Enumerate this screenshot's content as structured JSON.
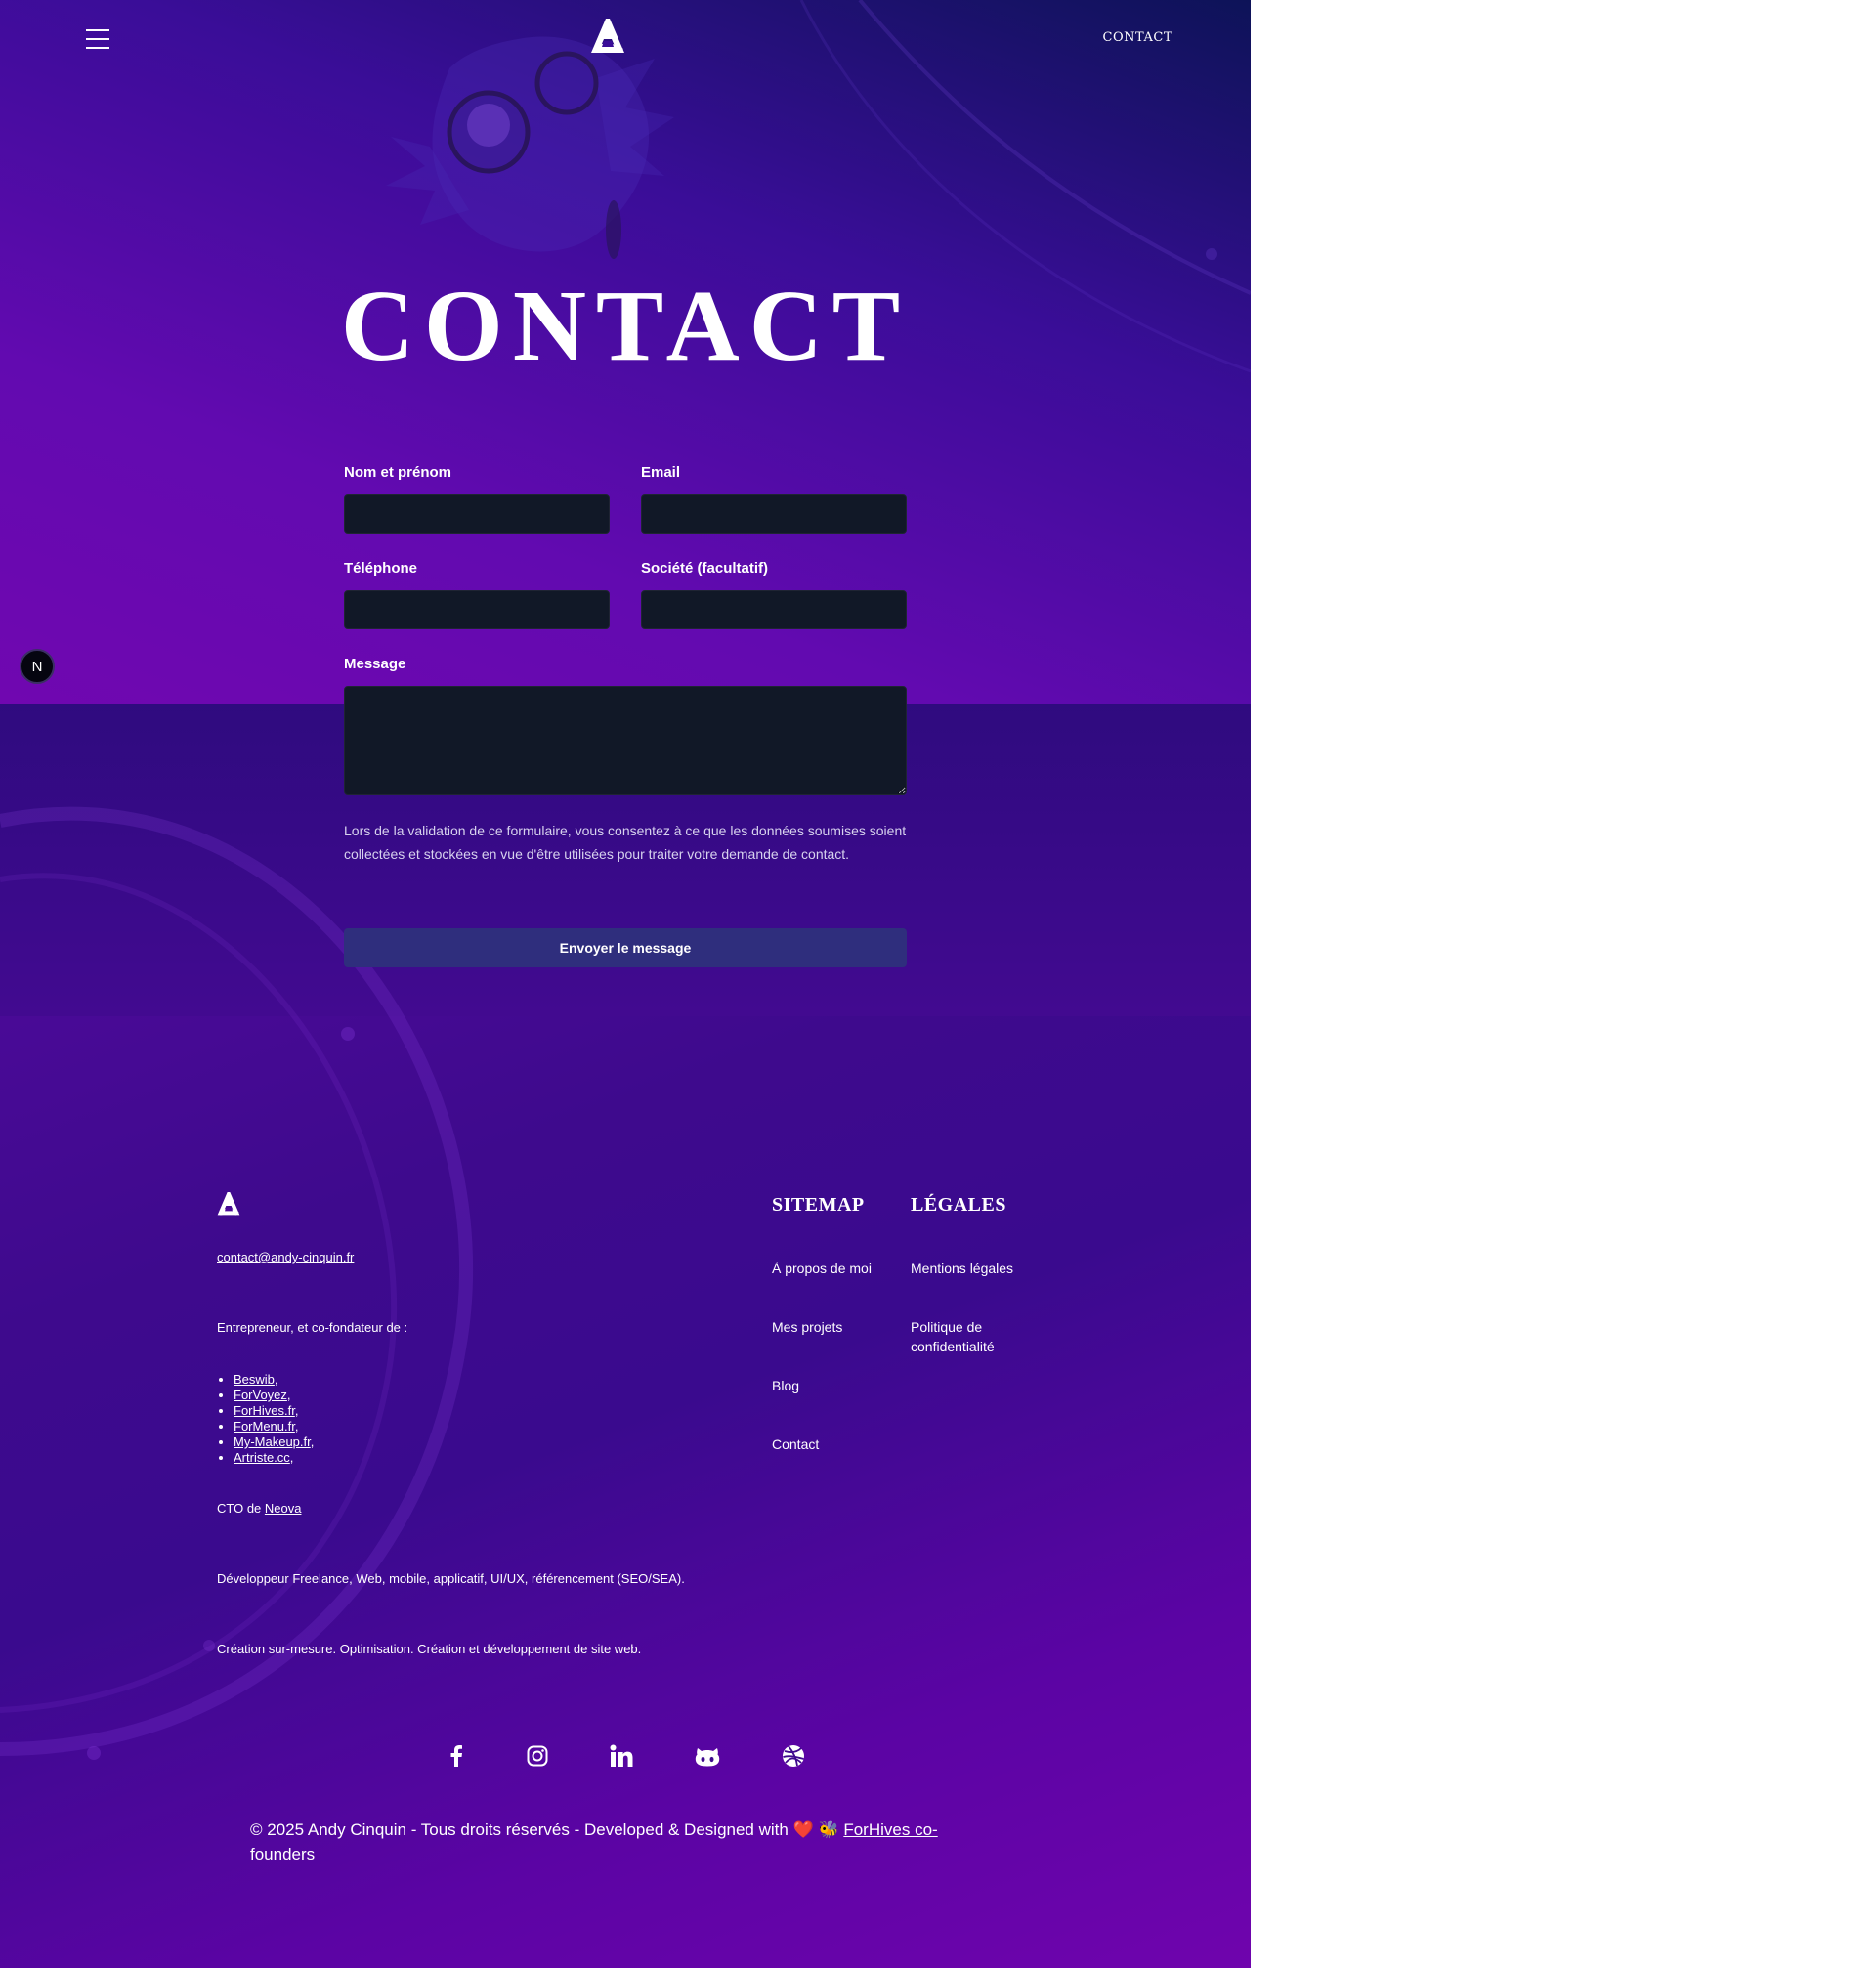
{
  "header": {
    "menu_icon": "hamburger-menu-icon",
    "logo_icon": "andy-cinquin-logo",
    "contact_link": "CONTACT"
  },
  "page": {
    "title": "CONTACT"
  },
  "form": {
    "name_label": "Nom et prénom",
    "name_value": "",
    "email_label": "Email",
    "email_value": "",
    "phone_label": "Téléphone",
    "phone_value": "",
    "company_label": "Société (facultatif)",
    "company_value": "",
    "message_label": "Message",
    "message_value": "",
    "consent_text": "Lors de la validation de ce formulaire, vous consentez à ce que les données soumises soient collectées et stockées en vue d'être utilisées pour traiter votre demande de contact.",
    "submit_label": "Envoyer le message"
  },
  "dev_badge": {
    "label": "N"
  },
  "footer": {
    "email": "contact@andy-cinquin.fr",
    "intro": "Entrepreneur, et co-fondateur de :",
    "ventures": [
      {
        "name": "Beswib",
        "sep": ","
      },
      {
        "name": "ForVoyez",
        "sep": ","
      },
      {
        "name": "ForHives.fr",
        "sep": ","
      },
      {
        "name": "ForMenu.fr",
        "sep": ","
      },
      {
        "name": "My-Makeup.fr",
        "sep": ","
      },
      {
        "name": "Artriste.cc",
        "sep": ","
      }
    ],
    "cto_prefix": "CTO de ",
    "cto_company": "Neova",
    "dev_line": "Développeur Freelance, Web, mobile, applicatif, UI/UX, référencement (SEO/SEA).",
    "creation_line": "Création sur-mesure. Optimisation. Création et développement de site web.",
    "sitemap": {
      "title": "SITEMAP",
      "links": [
        "À propos de moi",
        "Mes projets",
        "Blog",
        "Contact"
      ]
    },
    "legal": {
      "title": "LÉGALES",
      "links": [
        "Mentions légales",
        "Politique de confidentialité"
      ]
    },
    "socials": [
      "facebook-icon",
      "instagram-icon",
      "linkedin-icon",
      "github-icon",
      "dribbble-icon"
    ],
    "copyright_text": "© 2025 Andy Cinquin - Tous droits réservés - Developed & Designed with ❤️ 🐝 ",
    "copyright_link": "ForHives co-founders"
  },
  "colors": {
    "input_bg": "#111827",
    "button_bg": "#2f2e7d",
    "purple_dark": "#0b1152",
    "purple_bright": "#7007b0"
  }
}
